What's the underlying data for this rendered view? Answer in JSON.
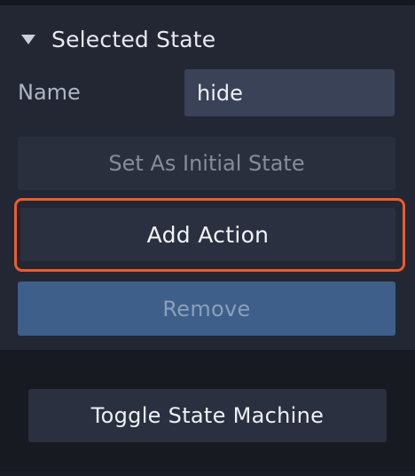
{
  "section": {
    "title": "Selected State",
    "expanded": true
  },
  "name_field": {
    "label": "Name",
    "value": "hide"
  },
  "buttons": {
    "set_initial_label": "Set As Initial State",
    "add_action_label": "Add Action",
    "remove_label": "Remove",
    "toggle_label": "Toggle State Machine"
  },
  "colors": {
    "highlight": "#ec5c2e",
    "remove_button": "#3e5f8a",
    "panel": "#232734"
  }
}
